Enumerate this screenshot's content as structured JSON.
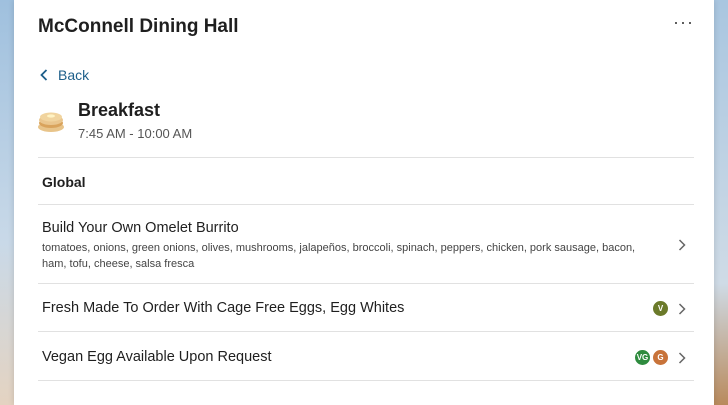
{
  "header": {
    "title": "McConnell Dining Hall",
    "more_icon": "more-horizontal-icon"
  },
  "nav": {
    "back_label": "Back"
  },
  "meal": {
    "title": "Breakfast",
    "time": "7:45 AM - 10:00 AM",
    "icon": "pancakes-icon"
  },
  "section": {
    "title": "Global"
  },
  "items": [
    {
      "name": "Build Your Own Omelet Burrito",
      "description": "tomatoes, onions, green onions, olives, mushrooms, jalapeños, broccoli, spinach, peppers, chicken, pork sausage, bacon, ham, tofu, cheese, salsa fresca",
      "badges": []
    },
    {
      "name": "Fresh Made To Order With Cage Free Eggs, Egg Whites",
      "description": "",
      "badges": [
        {
          "label": "V",
          "color": "#6b7a2a"
        }
      ]
    },
    {
      "name": "Vegan Egg Available Upon Request",
      "description": "",
      "badges": [
        {
          "label": "VG",
          "color": "#2e8b3e"
        },
        {
          "label": "G",
          "color": "#c8733a"
        }
      ]
    }
  ],
  "colors": {
    "link": "#1d5f8a",
    "divider": "#e1e1e1"
  }
}
